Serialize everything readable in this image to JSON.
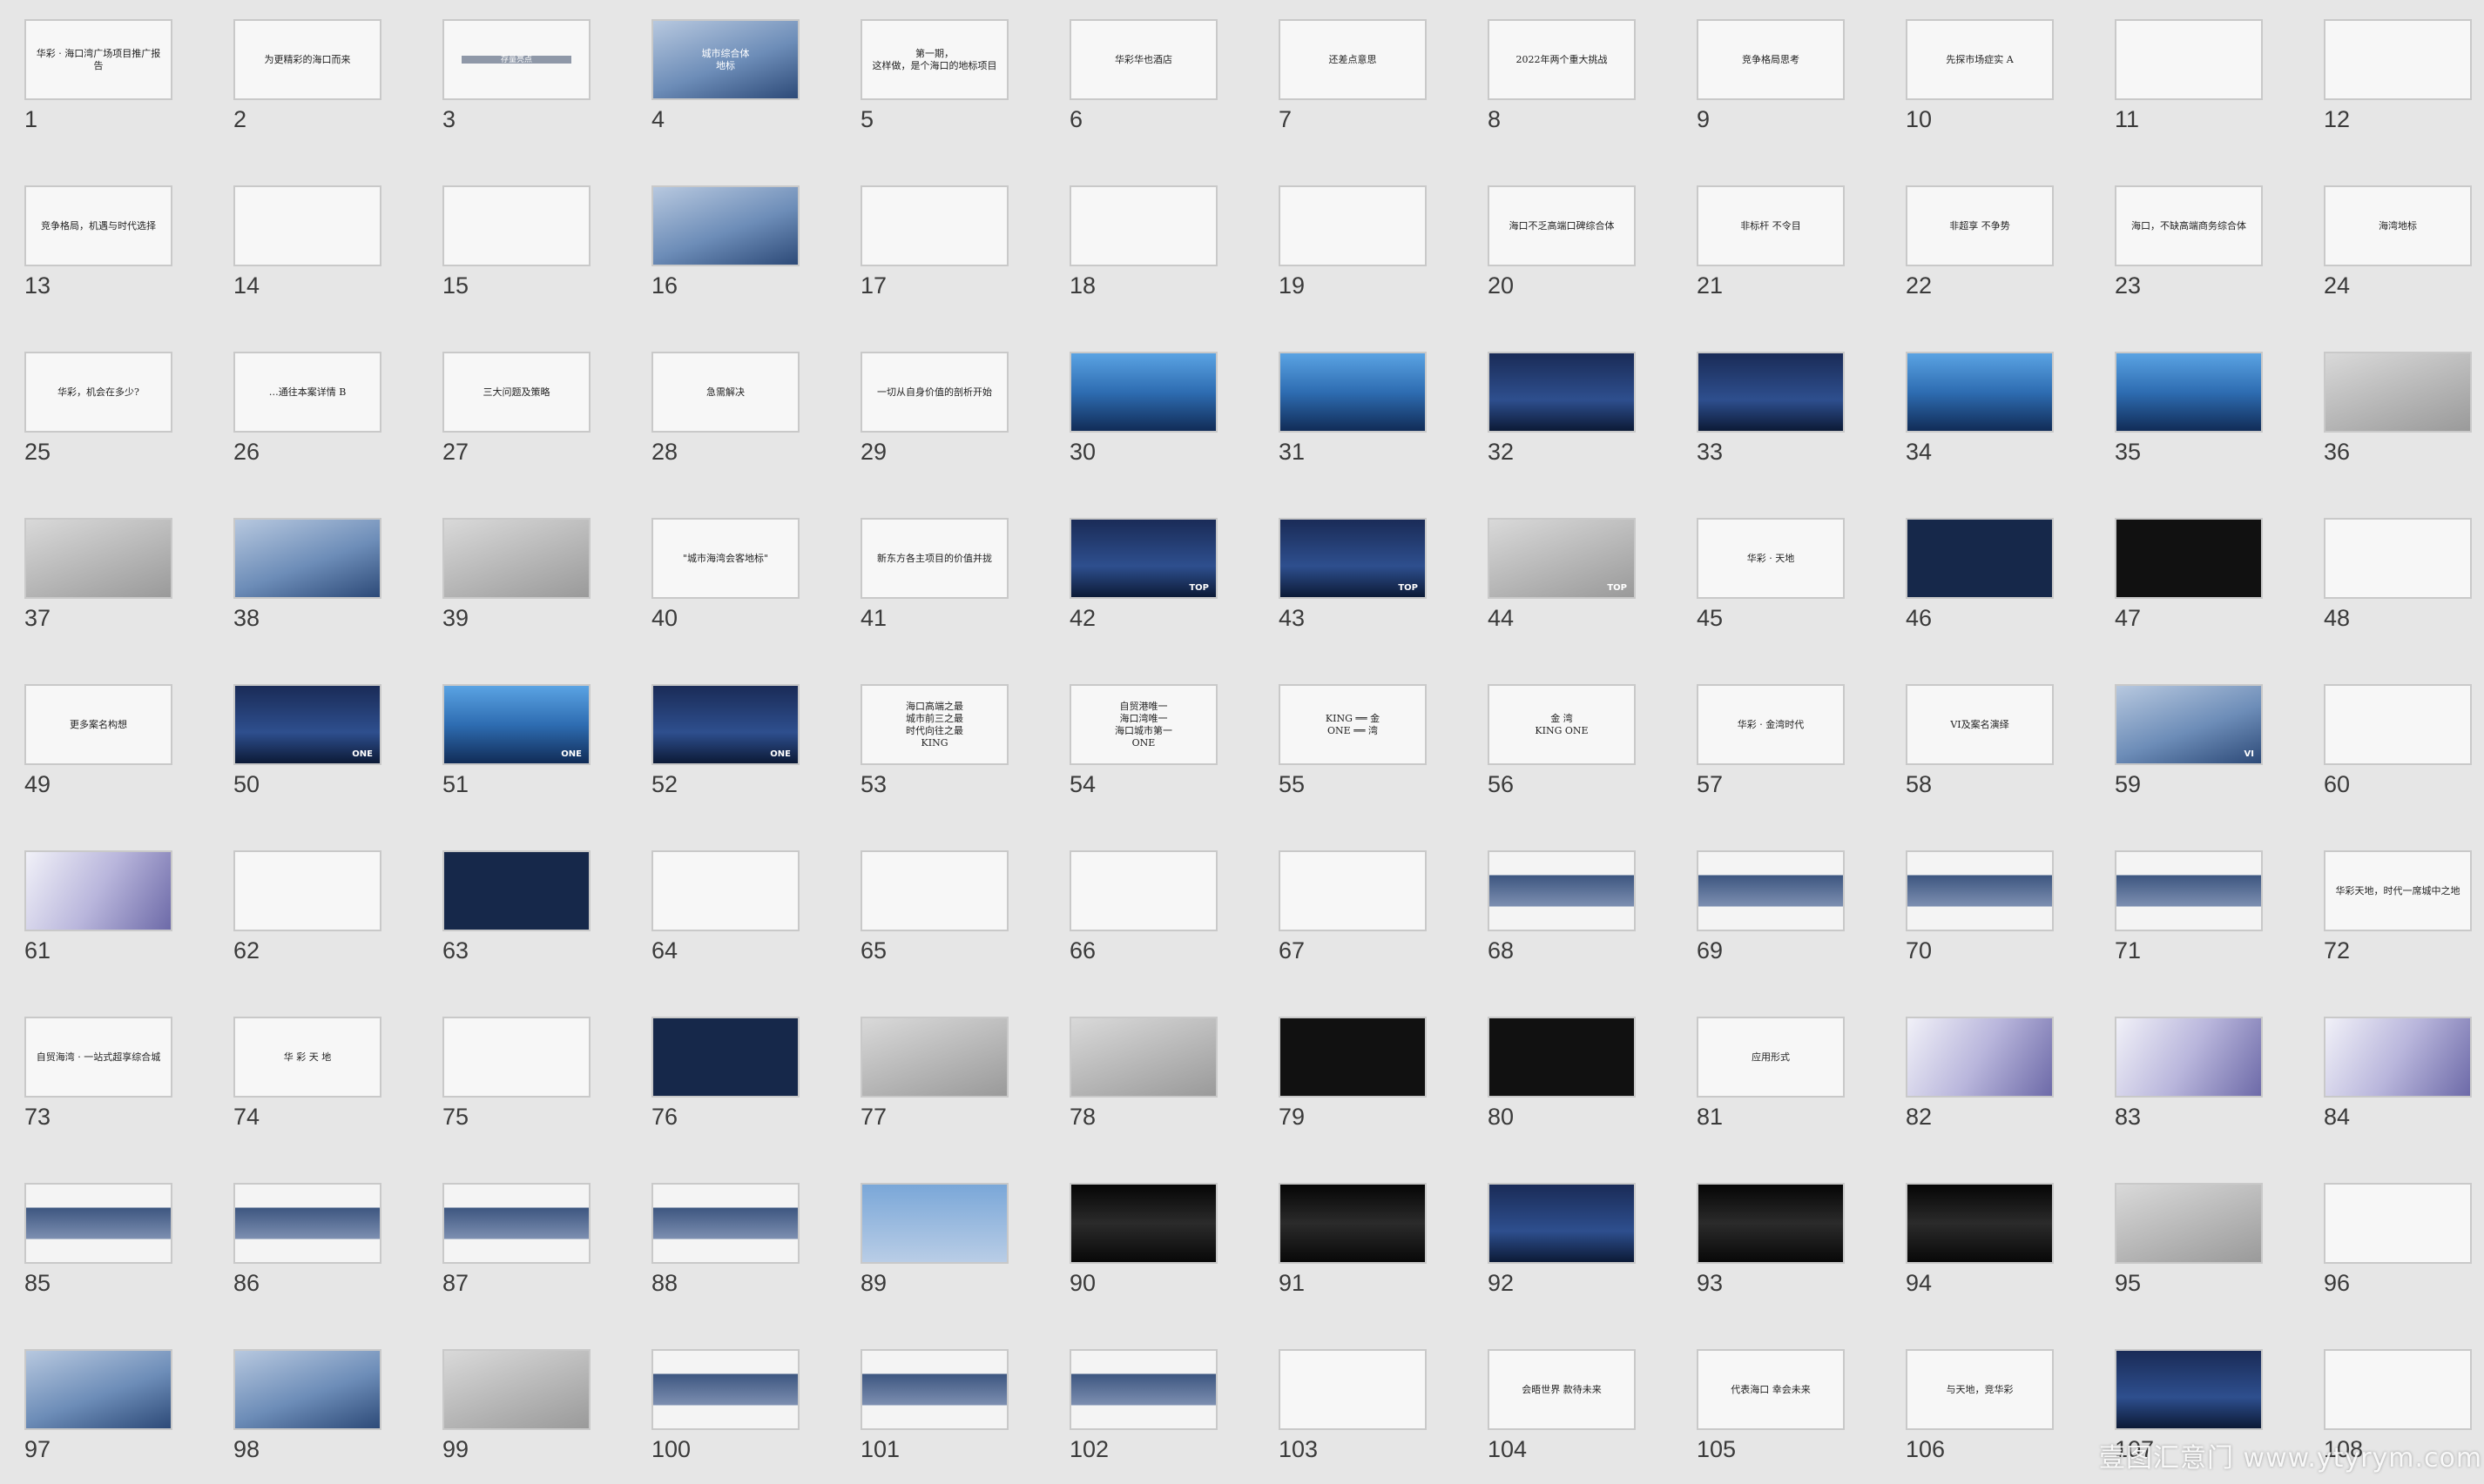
{
  "slides": [
    {
      "n": "1",
      "text": "华彩 · 海口湾广场项目推广报告",
      "style": "light"
    },
    {
      "n": "2",
      "text": "为更精彩的海口而来",
      "style": "light"
    },
    {
      "n": "3",
      "text": "存量亮点",
      "style": "accent"
    },
    {
      "n": "4",
      "text": "城市综合体\n地标",
      "style": "photo"
    },
    {
      "n": "5",
      "text": "第一期，\n这样做，是个海口的地标项目",
      "style": "light"
    },
    {
      "n": "6",
      "text": "华彩华也酒店",
      "style": "light"
    },
    {
      "n": "7",
      "text": "还差点意思",
      "style": "light"
    },
    {
      "n": "8",
      "text": "2022年两个重大挑战",
      "style": "light"
    },
    {
      "n": "9",
      "text": "竞争格局思考",
      "style": "light"
    },
    {
      "n": "10",
      "text": "先探市场症实 A",
      "style": "light"
    },
    {
      "n": "11",
      "text": "",
      "style": "light"
    },
    {
      "n": "12",
      "text": "",
      "style": "light"
    },
    {
      "n": "13",
      "text": "竞争格局，机遇与时代选择",
      "style": "light"
    },
    {
      "n": "14",
      "text": "",
      "style": "light"
    },
    {
      "n": "15",
      "text": "",
      "style": "light"
    },
    {
      "n": "16",
      "text": "",
      "style": "photo"
    },
    {
      "n": "17",
      "text": "",
      "style": "light"
    },
    {
      "n": "18",
      "text": "",
      "style": "light"
    },
    {
      "n": "19",
      "text": "",
      "style": "light"
    },
    {
      "n": "20",
      "text": "海口不乏高端口碑综合体",
      "style": "light"
    },
    {
      "n": "21",
      "text": "非标杆 不令目",
      "style": "light"
    },
    {
      "n": "22",
      "text": "非超享 不争势",
      "style": "light"
    },
    {
      "n": "23",
      "text": "海口，不缺高端商务综合体",
      "style": "light"
    },
    {
      "n": "24",
      "text": "海湾地标",
      "style": "light"
    },
    {
      "n": "25",
      "text": "华彩，机会在多少?",
      "style": "light"
    },
    {
      "n": "26",
      "text": "…通往本案详情 B",
      "style": "light"
    },
    {
      "n": "27",
      "text": "三大问题及策略",
      "style": "light"
    },
    {
      "n": "28",
      "text": "急需解决",
      "style": "light"
    },
    {
      "n": "29",
      "text": "一切从自身价值的剖析开始",
      "style": "light"
    },
    {
      "n": "30",
      "text": "",
      "style": "city"
    },
    {
      "n": "31",
      "text": "",
      "style": "city"
    },
    {
      "n": "32",
      "text": "",
      "style": "night"
    },
    {
      "n": "33",
      "text": "",
      "style": "night"
    },
    {
      "n": "34",
      "text": "",
      "style": "city"
    },
    {
      "n": "35",
      "text": "",
      "style": "city"
    },
    {
      "n": "36",
      "text": "",
      "style": "gray"
    },
    {
      "n": "37",
      "text": "",
      "style": "gray"
    },
    {
      "n": "38",
      "text": "",
      "style": "photo"
    },
    {
      "n": "39",
      "text": "",
      "style": "gray"
    },
    {
      "n": "40",
      "text": "\"城市海湾会客地标\"",
      "style": "light"
    },
    {
      "n": "41",
      "text": "新东方各主项目的价值并拢",
      "style": "light"
    },
    {
      "n": "42",
      "text": "TOP",
      "style": "night"
    },
    {
      "n": "43",
      "text": "TOP",
      "style": "night"
    },
    {
      "n": "44",
      "text": "TOP",
      "style": "gray"
    },
    {
      "n": "45",
      "text": "华彩 · 天地",
      "style": "light"
    },
    {
      "n": "46",
      "text": "",
      "style": "dark"
    },
    {
      "n": "47",
      "text": "",
      "style": "black"
    },
    {
      "n": "48",
      "text": "",
      "style": "light"
    },
    {
      "n": "49",
      "text": "更多案名构想",
      "style": "light"
    },
    {
      "n": "50",
      "text": "ONE",
      "style": "night"
    },
    {
      "n": "51",
      "text": "ONE",
      "style": "city"
    },
    {
      "n": "52",
      "text": "ONE",
      "style": "night"
    },
    {
      "n": "53",
      "text": "海口高端之最\n城市前三之最\n时代向往之最\nKING",
      "style": "light"
    },
    {
      "n": "54",
      "text": "自贸港唯一\n海口湾唯一\n海口城市第一\nONE",
      "style": "light"
    },
    {
      "n": "55",
      "text": "KING ══ 金\nONE ══ 湾",
      "style": "light"
    },
    {
      "n": "56",
      "text": "金  湾\nKING  ONE",
      "style": "light"
    },
    {
      "n": "57",
      "text": "华彩 · 金湾时代",
      "style": "light"
    },
    {
      "n": "58",
      "text": "VI及案名演绎",
      "style": "light"
    },
    {
      "n": "59",
      "text": "VI",
      "style": "photo"
    },
    {
      "n": "60",
      "text": "",
      "style": "light"
    },
    {
      "n": "61",
      "text": "",
      "style": "purple"
    },
    {
      "n": "62",
      "text": "",
      "style": "light"
    },
    {
      "n": "63",
      "text": "",
      "style": "dark"
    },
    {
      "n": "64",
      "text": "",
      "style": "light"
    },
    {
      "n": "65",
      "text": "",
      "style": "light"
    },
    {
      "n": "66",
      "text": "",
      "style": "light"
    },
    {
      "n": "67",
      "text": "",
      "style": "light"
    },
    {
      "n": "68",
      "text": "",
      "style": "banner"
    },
    {
      "n": "69",
      "text": "",
      "style": "banner"
    },
    {
      "n": "70",
      "text": "",
      "style": "banner"
    },
    {
      "n": "71",
      "text": "",
      "style": "banner"
    },
    {
      "n": "72",
      "text": "华彩天地，时代一席城中之地",
      "style": "light"
    },
    {
      "n": "73",
      "text": "自贸海湾 · 一站式超享综合城",
      "style": "light"
    },
    {
      "n": "74",
      "text": "华 彩 天 地",
      "style": "light"
    },
    {
      "n": "75",
      "text": "",
      "style": "light"
    },
    {
      "n": "76",
      "text": "",
      "style": "dark"
    },
    {
      "n": "77",
      "text": "",
      "style": "gray"
    },
    {
      "n": "78",
      "text": "",
      "style": "gray"
    },
    {
      "n": "79",
      "text": "",
      "style": "black"
    },
    {
      "n": "80",
      "text": "",
      "style": "black"
    },
    {
      "n": "81",
      "text": "应用形式",
      "style": "light"
    },
    {
      "n": "82",
      "text": "",
      "style": "purple"
    },
    {
      "n": "83",
      "text": "",
      "style": "purple"
    },
    {
      "n": "84",
      "text": "",
      "style": "purple"
    },
    {
      "n": "85",
      "text": "",
      "style": "banner"
    },
    {
      "n": "86",
      "text": "",
      "style": "banner"
    },
    {
      "n": "87",
      "text": "",
      "style": "banner"
    },
    {
      "n": "88",
      "text": "",
      "style": "banner"
    },
    {
      "n": "89",
      "text": "",
      "style": "billboard"
    },
    {
      "n": "90",
      "text": "",
      "style": "darkshow"
    },
    {
      "n": "91",
      "text": "",
      "style": "darkshow"
    },
    {
      "n": "92",
      "text": "",
      "style": "night"
    },
    {
      "n": "93",
      "text": "",
      "style": "darkshow"
    },
    {
      "n": "94",
      "text": "",
      "style": "darkshow"
    },
    {
      "n": "95",
      "text": "",
      "style": "gray"
    },
    {
      "n": "96",
      "text": "",
      "style": "light"
    },
    {
      "n": "97",
      "text": "",
      "style": "photo"
    },
    {
      "n": "98",
      "text": "",
      "style": "photo"
    },
    {
      "n": "99",
      "text": "",
      "style": "gray"
    },
    {
      "n": "100",
      "text": "",
      "style": "banner"
    },
    {
      "n": "101",
      "text": "",
      "style": "banner"
    },
    {
      "n": "102",
      "text": "",
      "style": "banner"
    },
    {
      "n": "103",
      "text": "",
      "style": "light"
    },
    {
      "n": "104",
      "text": "会晤世界 款待未来",
      "style": "light"
    },
    {
      "n": "105",
      "text": "代表海口 幸会未来",
      "style": "light"
    },
    {
      "n": "106",
      "text": "与天地，竞华彩",
      "style": "light"
    },
    {
      "n": "107",
      "text": "",
      "style": "night"
    },
    {
      "n": "108",
      "text": "",
      "style": "light"
    }
  ],
  "watermark": "壹图汇意门 www.ytyrym.com"
}
